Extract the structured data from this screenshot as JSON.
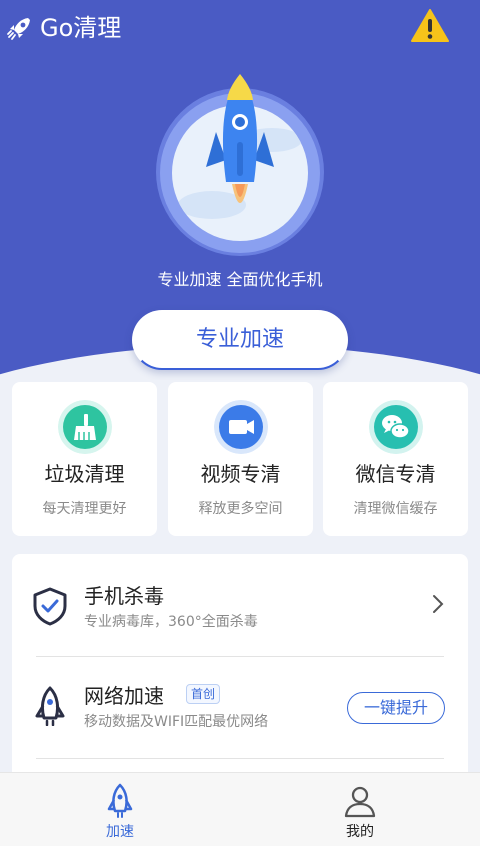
{
  "app": {
    "title": "Go清理"
  },
  "header": {
    "warning_icon": "warning-icon",
    "logo_icon": "rocket-logo-icon"
  },
  "hero": {
    "tagline": "专业加速 全面优化手机",
    "boost_button": "专业加速"
  },
  "cards": [
    {
      "title": "垃圾清理",
      "subtitle": "每天清理更好",
      "icon": "broom-icon",
      "color": "#2ec4a0"
    },
    {
      "title": "视频专清",
      "subtitle": "释放更多空间",
      "icon": "video-icon",
      "color": "#3b7be8"
    },
    {
      "title": "微信专清",
      "subtitle": "清理微信缓存",
      "icon": "wechat-icon",
      "color": "#27bfb0"
    }
  ],
  "list": [
    {
      "title": "手机杀毒",
      "subtitle": "专业病毒库，360°全面杀毒",
      "icon": "shield-check-icon"
    },
    {
      "title": "网络加速",
      "tag": "首创",
      "subtitle": "移动数据及WIFI匹配最优网络",
      "icon": "rocket-outline-icon",
      "action": "一键提升"
    }
  ],
  "tabbar": [
    {
      "label": "加速",
      "icon": "rocket-tab-icon",
      "active": true,
      "color": "#3a6ad8"
    },
    {
      "label": "我的",
      "icon": "user-icon",
      "active": false,
      "color": "#222222"
    }
  ],
  "colors": {
    "primary": "#4a5bc4",
    "accent": "#3a6ad8",
    "background": "#eef1f8"
  }
}
